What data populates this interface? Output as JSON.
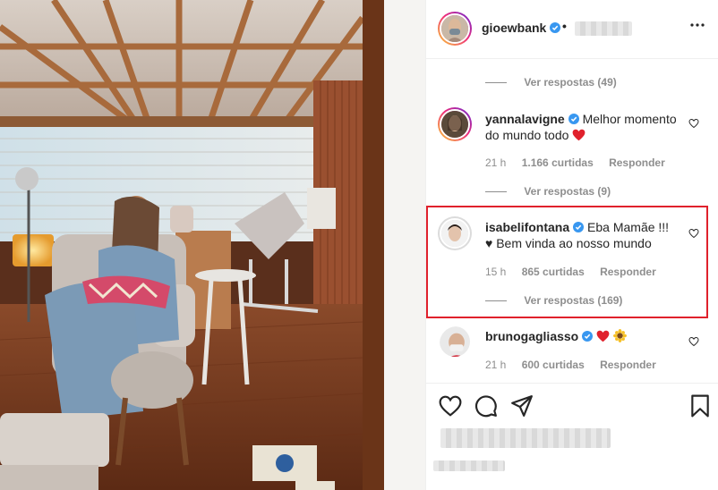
{
  "post": {
    "author": "gioewbank",
    "separator": "•"
  },
  "comments": [
    {
      "type": "replies",
      "label": "Ver respostas (49)"
    },
    {
      "type": "comment",
      "username": "yannalavigne",
      "text": "Melhor momento do mundo todo",
      "emoji": "red-heart",
      "time": "21 h",
      "likes": "1.166 curtidas",
      "reply": "Responder",
      "verified": true
    },
    {
      "type": "replies",
      "label": "Ver respostas (9)"
    },
    {
      "type": "comment",
      "username": "isabelifontana",
      "text_line1": "Eba Mamãe !!!",
      "text_line2": "♥ Bem vinda ao nosso mundo",
      "time": "15 h",
      "likes": "865 curtidas",
      "reply": "Responder",
      "verified": true,
      "highlighted": true
    },
    {
      "type": "replies",
      "label": "Ver respostas (169)"
    },
    {
      "type": "comment",
      "username": "brunogagliasso",
      "emoji": "red-heart + sunflower",
      "time": "21 h",
      "likes": "600 curtidas",
      "reply": "Responder",
      "verified": true
    }
  ],
  "icons": {
    "like": "heart-icon",
    "comment": "comment-icon",
    "share": "share-icon",
    "save": "bookmark-icon",
    "more": "more-options-icon"
  },
  "colors": {
    "verified": "#3897f0",
    "highlight_border": "#e0212c",
    "heart_red": "#ed4956",
    "muted_text": "#8e8e8e"
  }
}
